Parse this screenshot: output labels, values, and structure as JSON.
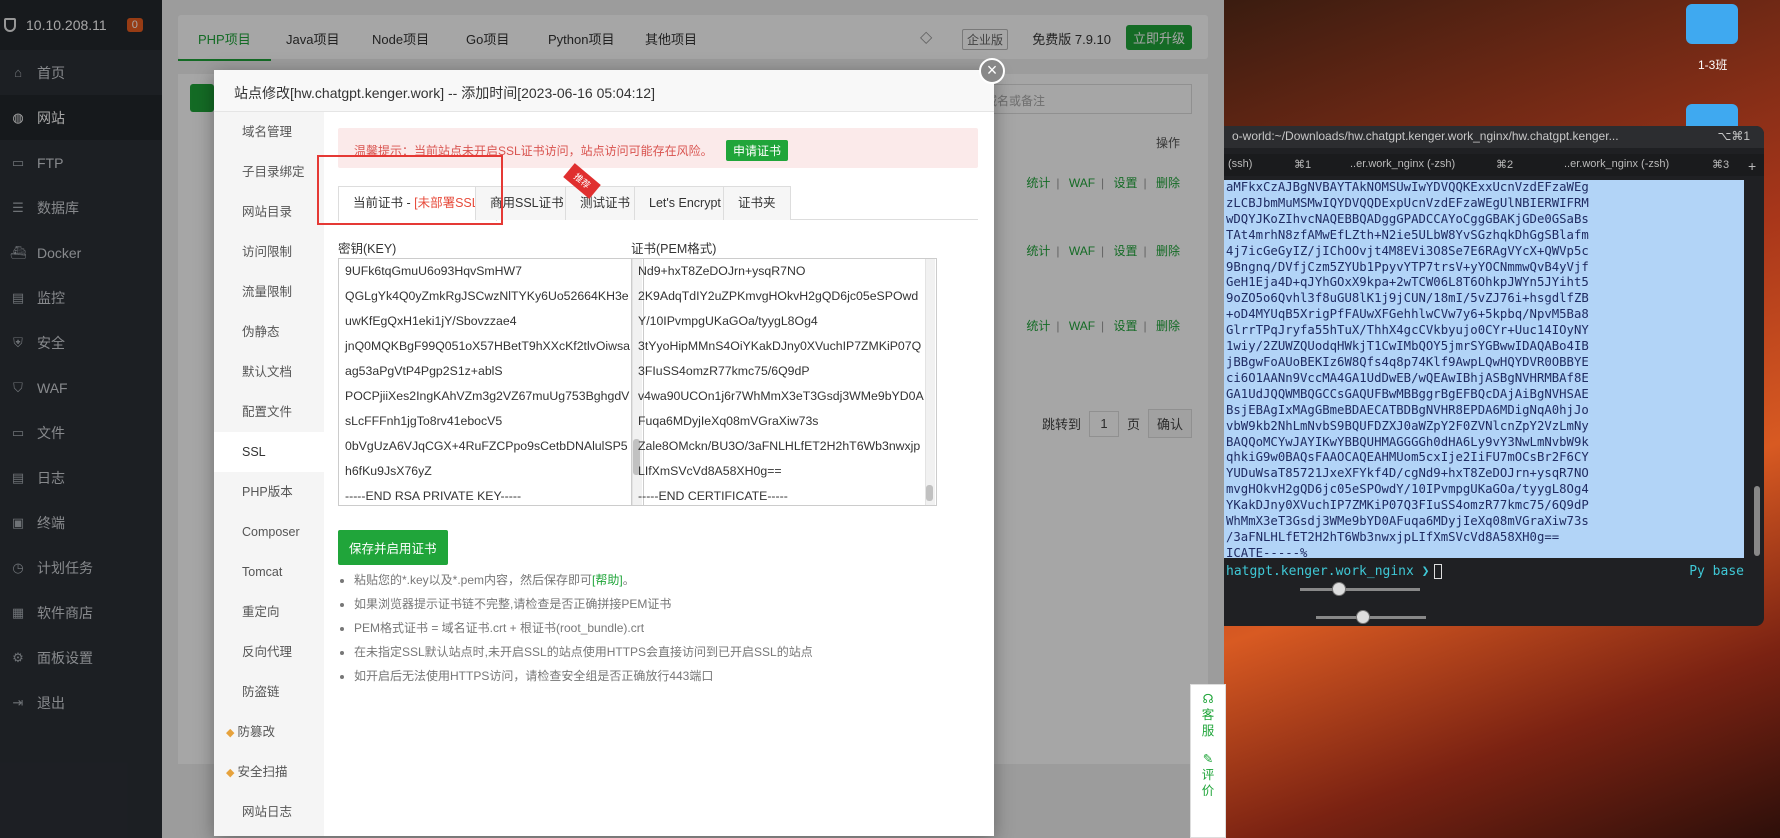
{
  "sidebar": {
    "ip": "10.10.208.11",
    "badge": "0",
    "items": [
      {
        "label": "首页",
        "icon": "home-icon",
        "glyph": "⌂"
      },
      {
        "label": "网站",
        "icon": "globe-icon",
        "glyph": "◍"
      },
      {
        "label": "FTP",
        "icon": "ftp-icon",
        "glyph": "▭"
      },
      {
        "label": "数据库",
        "icon": "database-icon",
        "glyph": "☰"
      },
      {
        "label": "Docker",
        "icon": "docker-icon",
        "glyph": "⛴"
      },
      {
        "label": "监控",
        "icon": "monitor-icon",
        "glyph": "▤"
      },
      {
        "label": "安全",
        "icon": "shield-icon",
        "glyph": "⛨"
      },
      {
        "label": "WAF",
        "icon": "waf-icon",
        "glyph": "⛉"
      },
      {
        "label": "文件",
        "icon": "folder-icon",
        "glyph": "▭"
      },
      {
        "label": "日志",
        "icon": "log-icon",
        "glyph": "▤"
      },
      {
        "label": "终端",
        "icon": "terminal-icon",
        "glyph": "▣"
      },
      {
        "label": "计划任务",
        "icon": "clock-icon",
        "glyph": "◷"
      },
      {
        "label": "软件商店",
        "icon": "apps-icon",
        "glyph": "▦"
      },
      {
        "label": "面板设置",
        "icon": "gear-icon",
        "glyph": "⚙"
      },
      {
        "label": "退出",
        "icon": "logout-icon",
        "glyph": "⇥"
      }
    ]
  },
  "topbar": {
    "tabs": [
      "PHP项目",
      "Java项目",
      "Node项目",
      "Go项目",
      "Python项目",
      "其他项目"
    ],
    "enterprise": "企业版",
    "version": "免费版  7.9.10",
    "upgrade": "立即升级"
  },
  "sites": {
    "search_placeholder": "输入域名或备注",
    "ops_header": "操作",
    "row_links": [
      "统计",
      "WAF",
      "设置",
      "删除"
    ],
    "pager_jump": "跳转到",
    "pager_page": "1",
    "pager_unit": "页",
    "pager_confirm": "确认"
  },
  "modal": {
    "title": "站点修改[hw.chatgpt.kenger.work] -- 添加时间[2023-06-16 05:04:12]",
    "close": "×",
    "menu": [
      {
        "label": "域名管理",
        "gem": false
      },
      {
        "label": "子目录绑定",
        "gem": false
      },
      {
        "label": "网站目录",
        "gem": false
      },
      {
        "label": "访问限制",
        "gem": false
      },
      {
        "label": "流量限制",
        "gem": false
      },
      {
        "label": "伪静态",
        "gem": false
      },
      {
        "label": "默认文档",
        "gem": false
      },
      {
        "label": "配置文件",
        "gem": false
      },
      {
        "label": "SSL",
        "gem": false
      },
      {
        "label": "PHP版本",
        "gem": false
      },
      {
        "label": "Composer",
        "gem": false
      },
      {
        "label": "Tomcat",
        "gem": false
      },
      {
        "label": "重定向",
        "gem": false
      },
      {
        "label": "反向代理",
        "gem": false
      },
      {
        "label": "防盗链",
        "gem": false
      },
      {
        "label": "防篡改",
        "gem": true
      },
      {
        "label": "安全扫描",
        "gem": true
      },
      {
        "label": "网站日志",
        "gem": false
      }
    ],
    "warning": "温馨提示：当前站点未开启SSL证书访问，站点访问可能存在风险。",
    "apply_cert": "申请证书",
    "tabs": {
      "current_prefix": "当前证书 - ",
      "current_status": "[未部署SSL]",
      "commercial": "商用SSL证书",
      "ribbon": "推荐",
      "test": "测试证书",
      "letsencrypt": "Let's Encrypt",
      "folder": "证书夹"
    },
    "key_label": "密钥(KEY)",
    "cert_label": "证书(PEM格式)",
    "key_lines": [
      "9UFk6tqGmuU6o93HqvSmHW7",
      "QGLgYk4Q0yZmkRgJSCwzNlTYKy6Uo52664KH3e",
      "uwKfEgQxH1eki1jY/Sbovzzae4",
      "jnQ0MQKBgF99Q051oX57HBetT9hXXcKf2tlvOiwsa",
      "ag53aPgVtP4Pgp2S1z+ablS",
      "POCPjiiXes2IngKAhVZm3g2VZ67muUg753BghgdV",
      "sLcFFFnh1jgTo8rv41ebocV5",
      "0bVgUzA6VJqCGX+4RuFZCPpo9sCetbDNAlulSP5",
      "h6fKu9JsX76yZ",
      "-----END RSA PRIVATE KEY-----"
    ],
    "cert_lines": [
      "Nd9+hxT8ZeDOJrn+ysqR7NO",
      "2K9AdqTdIY2uZPKmvgHOkvH2gQD6jc05eSPOwd",
      "Y/10IPvmpgUKaGOa/tyygL8Og4",
      "3tYyoHipMMnS4OiYKakDJny0XVuchIP7ZMKiP07Q",
      "3FIuSS4omzR77kmc75/6Q9dP",
      "v4wa90UCOn1j6r7WhMmX3eT3Gsdj3WMe9bYD0A",
      "Fuqa6MDyjIeXq08mVGraXiw73s",
      "Zale8OMckn/BU3O/3aFNLHLfET2H2hT6Wb3nwxjp",
      "LIfXmSVcVd8A58XH0g==",
      "-----END CERTIFICATE-----"
    ],
    "save_button": "保存并启用证书",
    "tips": {
      "t1_a": "粘贴您的*.key以及*.pem内容，然后保存即可",
      "t1_help": "[帮助]",
      "t1_b": "。",
      "t2": "如果浏览器提示证书链不完整,请检查是否正确拼接PEM证书",
      "t3": "PEM格式证书 = 域名证书.crt + 根证书(root_bundle).crt",
      "t4": "在未指定SSL默认站点时,未开启SSL的站点使用HTTPS会直接访问到已开启SSL的站点",
      "t5": "如开启后无法使用HTTPS访问，请检查安全组是否正确放行443端口"
    }
  },
  "float_service": {
    "service": "客服",
    "review": "评价"
  },
  "desktop": {
    "folder_label": "1-3班"
  },
  "terminal": {
    "title": "o-world:~/Downloads/hw.chatgpt.kenger.work_nginx/hw.chatgpt.kenger...",
    "title_shortcut": "⌥⌘1",
    "tabs": [
      "(ssh)",
      "⌘1",
      "..er.work_nginx (-zsh)",
      "⌘2",
      "..er.work_nginx (-zsh)",
      "⌘3"
    ],
    "lines": [
      "aMFkxCzAJBgNVBAYTAkNOMSUwIwYDVQQKExxUcnVzdEFzaWEg",
      "zLCBJbmMuMSMwIQYDVQQDExpUcnVzdEFzaWEgUlNBIERWIFRM",
      "wDQYJKoZIhvcNAQEBBQADggGPADCCAYoCggGBAKjGDe0GSaBs",
      "TAt4mrhN8zfAMwEfLZth+N2ie5ULbW8YvSGzhqkDhGgSBlafm",
      "4j7icGeGyIZ/jIChOOvjt4M8EVi3O8Se7E6RAgVYcX+QWVp5c",
      "9Bngnq/DVfjCzm5ZYUb1PpyvYTP7trsV+yYOCNmmwQvB4yVjf",
      "GeH1Eja4D+qJYhGOxX9kpa+2wTCW06L8T6OhkpJWYn5JYiht5",
      "9oZO5o6Qvhl3f8uGU8lK1j9jCUN/18mI/5vZJ76i+hsgdlfZB",
      "+oD4MYUqB5XrigPfFAUwXFGehhlwCVw7y6+5kpbq/NpvM5Ba8",
      "GlrrTPqJryfa55hTuX/ThhX4gcCVkbyujo0CYr+Uuc14IOyNY",
      "1wiy/2ZUWZQUodqHWkjT1CwIMbQOY5jmrSYGBwwIDAQABo4IB",
      "jBBgwFoAUoBEKIz6W8Qfs4q8p74Klf9AwpLQwHQYDVR0OBBYE",
      "ci6O1AANn9VccMA4GA1UdDwEB/wQEAwIBhjASBgNVHRMBAf8E",
      "GA1UdJQQWMBQGCCsGAQUFBwMBBggrBgEFBQcDAjAiBgNVHSAE",
      "BsjEBAgIxMAgGBmeBDAECATBDBgNVHR8EPDA6MDigNqA0hjJo",
      "vbW9kb2NhLmNvbS9BQUFDZXJ0aWZpY2F0ZVNlcnZpY2VzLmNy",
      "BAQQoMCYwJAYIKwYBBQUHMAGGGGh0dHA6Ly9vY3NwLmNvbW9k",
      "qhkiG9w0BAQsFAAOCAQEAHMUom5cxIje2IiFU7mOCsBr2F6CY",
      "YUDuWsaT85721JxeXFYkf4D/cgNd9+hxT8ZeDOJrn+ysqR7NO",
      "mvgHOkvH2gQD6jc05eSPOwdY/10IPvmpgUKaGOa/tyygL8Og4",
      "YKakDJny0XVuchIP7ZMKiP07Q3FIuSS4omzR77kmc75/6Q9dP",
      "WhMmX3eT3Gsdj3WMe9bYD0AFuqa6MDyjIeXq08mVGraXiw73s",
      "/3aFNLHLfET2H2hT6Wb3nwxjpLIfXmSVcVd8A58XH0g==",
      "ICATE-----%"
    ],
    "prompt": "hatgpt.kenger.work_nginx ❯",
    "right_prompt": "Py base"
  }
}
